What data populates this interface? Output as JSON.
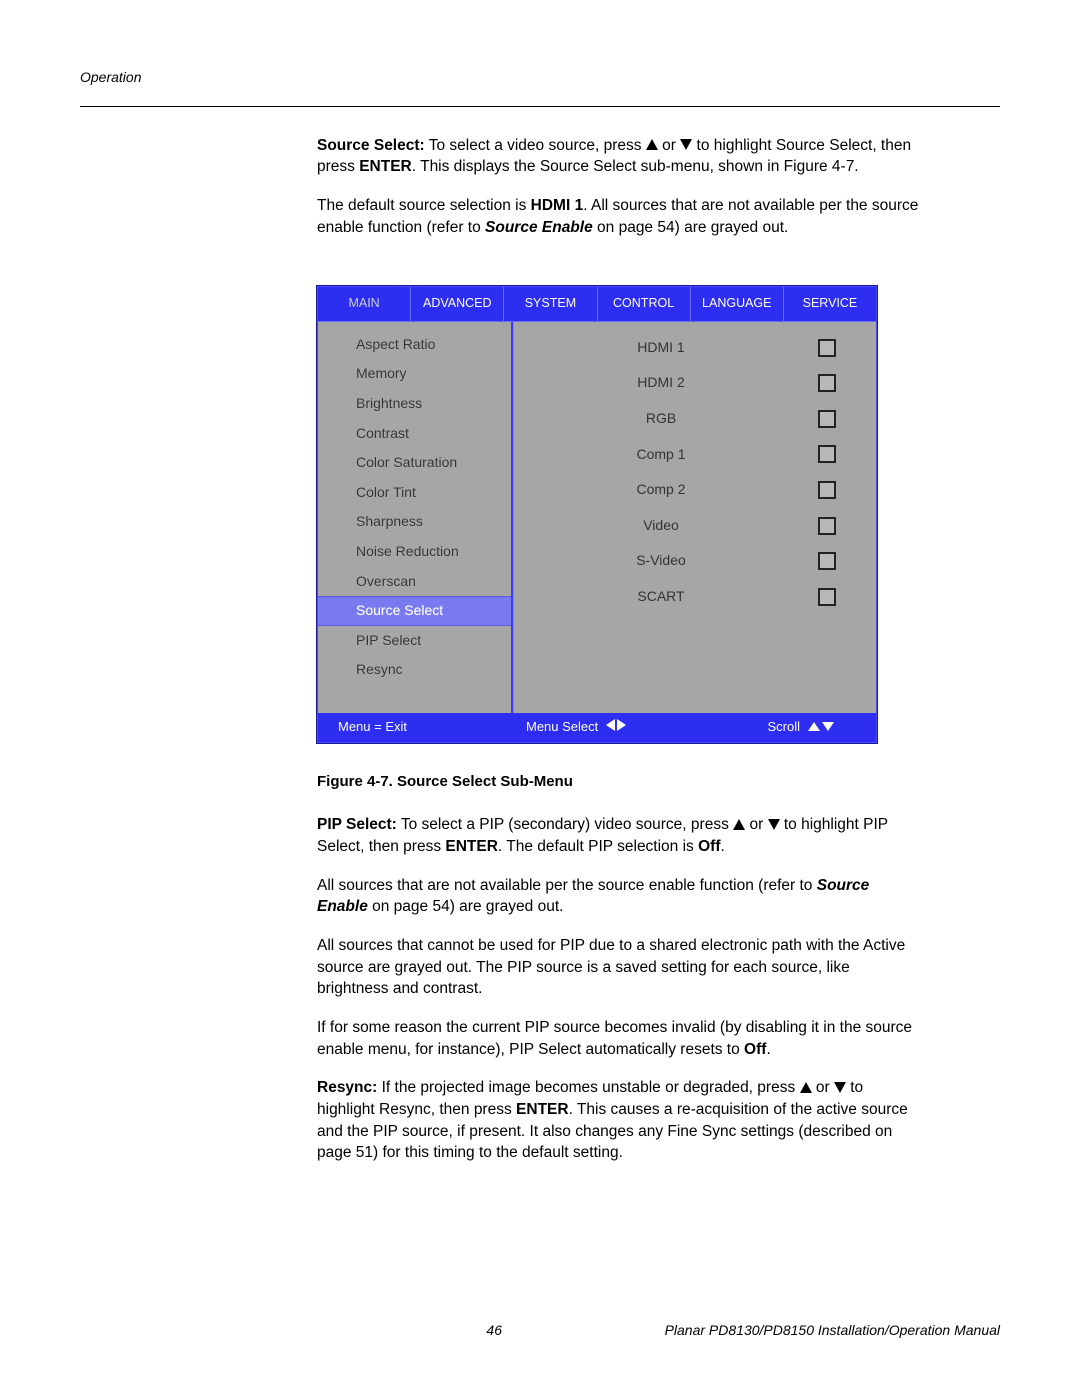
{
  "header": {
    "section": "Operation"
  },
  "para1": {
    "lead": "Source Select:",
    "t1": " To select a video source, press ",
    "t2": " or ",
    "t3": " to highlight Source Select, then press ",
    "enter": "ENTER",
    "t4": ". This displays the Source Select sub-menu, shown in Figure 4-7."
  },
  "para2": {
    "t1": "The default source selection is ",
    "hdmi": "HDMI 1",
    "t2": ". All sources that are not available per the source enable function (refer to ",
    "se": "Source Enable",
    "t3": " on page 54) are grayed out."
  },
  "osd": {
    "tabs": [
      "MAIN",
      "ADVANCED",
      "SYSTEM",
      "CONTROL",
      "LANGUAGE",
      "SERVICE"
    ],
    "left_items": [
      "Aspect Ratio",
      "Memory",
      "Brightness",
      "Contrast",
      "Color Saturation",
      "Color Tint",
      "Sharpness",
      "Noise Reduction",
      "Overscan",
      "Source Select",
      "PIP Select",
      "Resync"
    ],
    "highlight_index": 9,
    "right_items": [
      "HDMI 1",
      "HDMI 2",
      "RGB",
      "Comp 1",
      "Comp 2",
      "Video",
      "S-Video",
      "SCART"
    ],
    "footer": {
      "exit": "Menu = Exit",
      "select": "Menu Select",
      "scroll": "Scroll"
    }
  },
  "fig_caption": "Figure 4-7. Source Select Sub-Menu",
  "para3": {
    "lead": "PIP Select:",
    "t1": " To select a PIP (secondary) video source, press ",
    "t2": " or ",
    "t3": " to highlight PIP Select, then press ",
    "enter": "ENTER",
    "t4": ". The default PIP selection is ",
    "off": "Off",
    "t5": "."
  },
  "para4": {
    "t1": "All sources that are not available per the source enable function (refer to ",
    "se": "Source Enable",
    "t2": " on page 54) are grayed out."
  },
  "para5": {
    "t1": "All sources that cannot be used for PIP due to a shared electronic path with the Active source are grayed out. The PIP source is a saved setting for each source, like brightness and contrast."
  },
  "para6": {
    "t1": "If for some reason the current PIP source becomes invalid (by disabling it in the source enable menu, for instance), PIP Select automatically resets to ",
    "off": "Off",
    "t2": "."
  },
  "para7": {
    "lead": "Resync:",
    "t1": " If the projected image becomes unstable or degraded, press ",
    "t2": " or ",
    "t3": " to highlight Resync, then press ",
    "enter": "ENTER",
    "t4": ". This causes a re-acquisition of the active source and the PIP source, if present. It also changes any Fine Sync settings (described on page 51) for this timing to the default setting."
  },
  "footer": {
    "page": "46",
    "title": "Planar PD8130/PD8150 Installation/Operation Manual"
  }
}
